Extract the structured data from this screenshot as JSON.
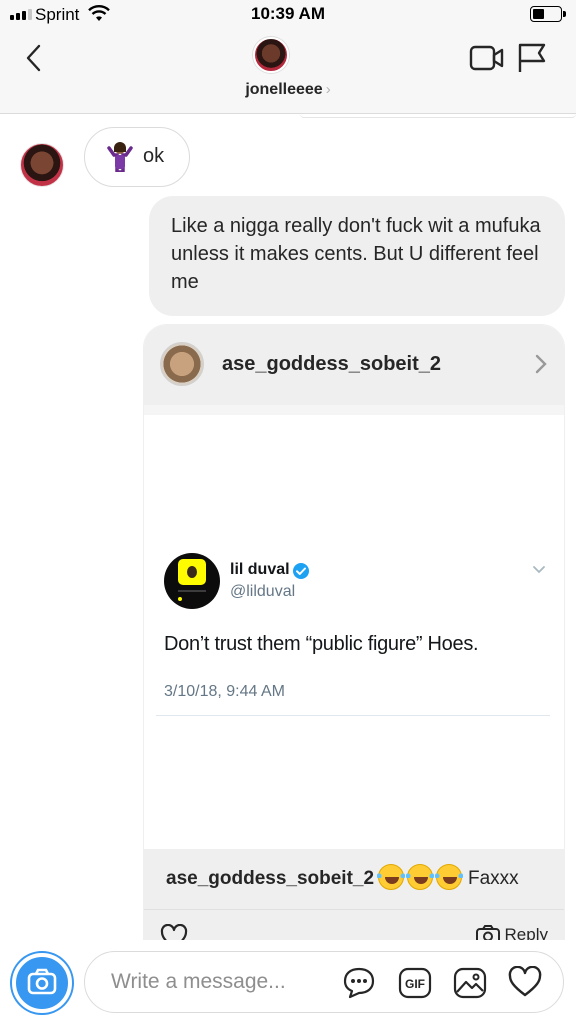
{
  "status_bar": {
    "carrier": "Sprint",
    "time": "10:39 AM"
  },
  "header": {
    "username": "jonelleeee",
    "chevron": "›",
    "icons": [
      "back-arrow-icon",
      "video-call-icon",
      "flag-icon"
    ]
  },
  "messages": [
    {
      "from": "peer",
      "emoji_icon": "person-shrugging-icon",
      "text": "ok"
    },
    {
      "from": "me",
      "text": "Like a nigga really don't fuck wit a mufuka unless it makes cents. But U different feel me"
    }
  ],
  "shared_post": {
    "username": "ase_goddess_sobeit_2",
    "tweet": {
      "name": "lil duval",
      "handle": "@lilduval",
      "text": "Don’t trust them “public figure” Hoes.",
      "date": "3/10/18, 9:44 AM"
    },
    "caption": {
      "username": "ase_goddess_sobeit_2",
      "emojis": [
        "laughing-tears-icon",
        "laughing-tears-icon",
        "laughing-tears-icon"
      ],
      "text": "Faxxx"
    },
    "reply_label": "Reply"
  },
  "composer": {
    "placeholder": "Write a message..."
  },
  "colors": {
    "accent": "#3897f0",
    "bubble_out": "#efefef",
    "verified": "#1da1f2"
  }
}
